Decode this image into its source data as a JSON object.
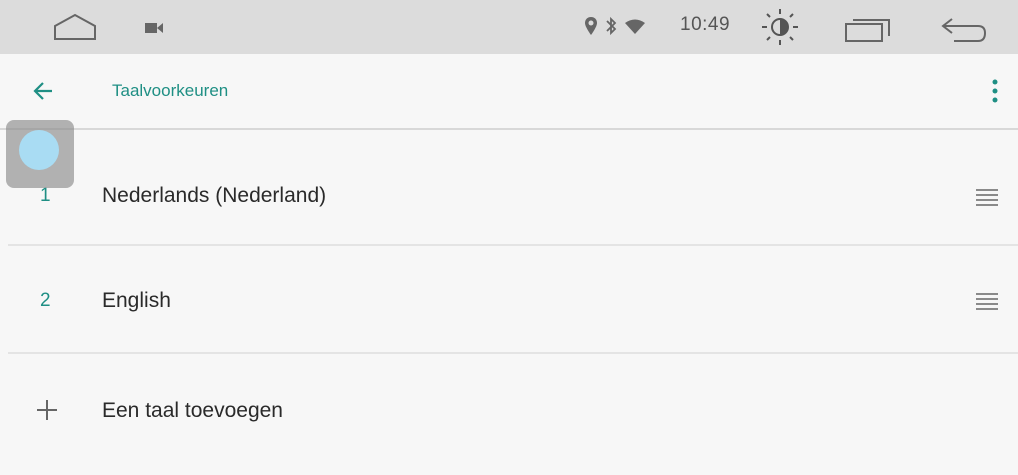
{
  "statusbar": {
    "time": "10:49",
    "icons": [
      "home-icon",
      "video-camera-icon",
      "location-icon",
      "bluetooth-icon",
      "wifi-icon",
      "brightness-icon",
      "recent-apps-icon",
      "back-nav-icon"
    ]
  },
  "appbar": {
    "title": "Taalvoorkeuren",
    "back_icon": "arrow-left-icon",
    "overflow_icon": "more-vert-icon"
  },
  "languages": [
    {
      "number": "1",
      "label": "Nederlands (Nederland)"
    },
    {
      "number": "2",
      "label": "English"
    }
  ],
  "add_language": {
    "label": "Een taal toevoegen",
    "icon": "plus-icon"
  },
  "colors": {
    "accent": "#1f8f84",
    "statusbar_bg": "#dcdcdc",
    "background": "#f7f7f7",
    "touch_dot": "#a9dcf3"
  }
}
